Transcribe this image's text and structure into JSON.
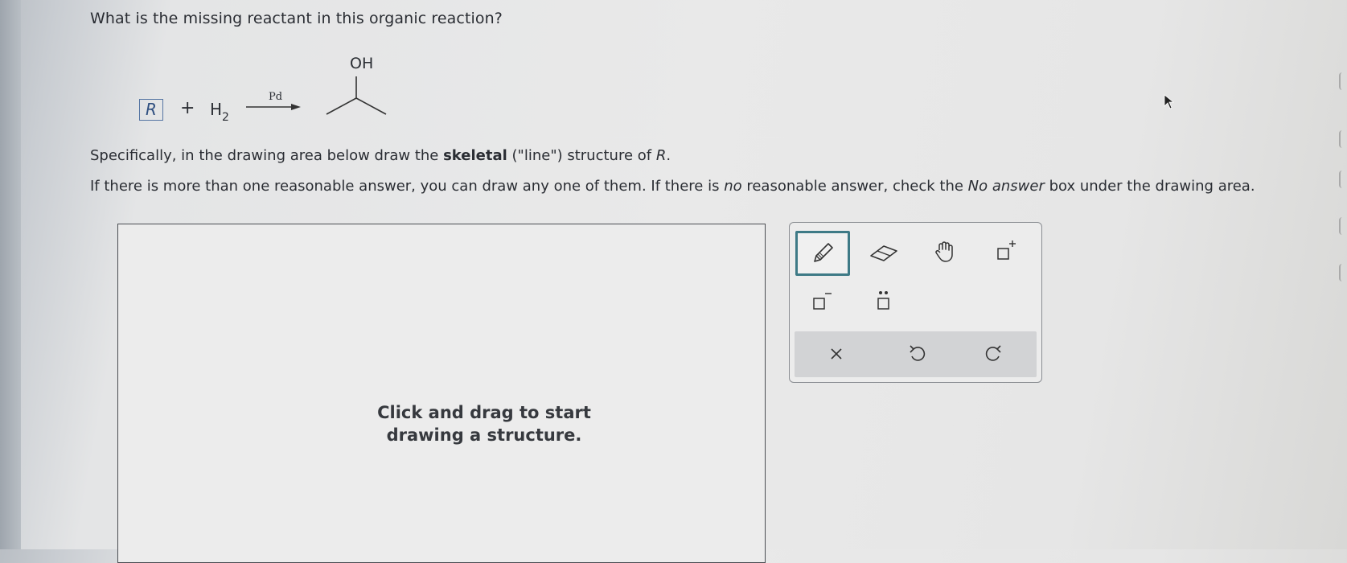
{
  "question": "What is the missing reactant in this organic reaction?",
  "reaction": {
    "reactant_box": "R",
    "plus": "+",
    "h2_main": "H",
    "h2_sub": "2",
    "catalyst": "Pd",
    "product_label": "OH"
  },
  "instructions": {
    "spec_1": "Specifically, in the drawing area below draw the ",
    "spec_bold": "skeletal",
    "spec_2": " (\"line\") structure of ",
    "spec_italic": "R",
    "spec_3": ".",
    "if_1": "If there is more than one reasonable answer, you can draw any one of them. If there is ",
    "if_italic1": "no",
    "if_2": " reasonable answer, check the ",
    "if_italic2": "No answer",
    "if_3": " box under the drawing area."
  },
  "drawing_area": {
    "hint": "Click and drag to start drawing a structure."
  },
  "toolbar": {
    "tools": [
      "pencil-icon",
      "eraser-icon",
      "hand-icon",
      "positive-charge-icon",
      "negative-charge-icon",
      "lone-pair-icon"
    ],
    "actions": [
      "clear-icon",
      "undo-icon",
      "redo-icon"
    ]
  },
  "colors": {
    "accent": "#3e7a86",
    "r_box": "#5575a3"
  }
}
